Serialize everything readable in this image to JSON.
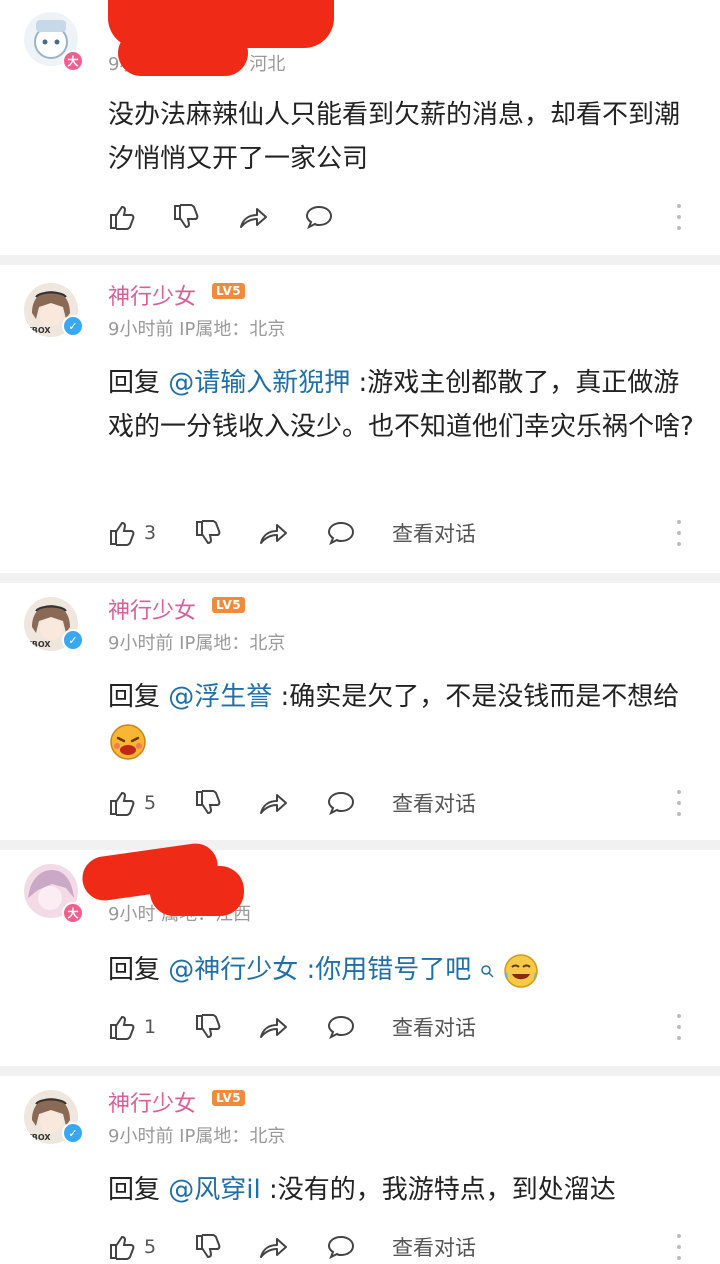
{
  "comments": [
    {
      "name": "",
      "meta": "9小时前 IP属地：河北",
      "body_pre": "没办法麻辣仙人只能看到欠薪的消息，却看不到潮汐悄悄又开了一家公司",
      "reply_to": "",
      "likes": "",
      "view_conversation": ""
    },
    {
      "name": "神行少女",
      "level": "LV5",
      "meta": "9小时前 IP属地：北京",
      "reply_prefix": "回复 ",
      "reply_to": "@请输入新猊押",
      "body": " :游戏主创都散了，真正做游戏的一分钱收入没少。也不知道他们幸灾乐祸个啥?",
      "likes": "3",
      "view_conversation": "查看对话"
    },
    {
      "name": "神行少女",
      "level": "LV5",
      "meta": "9小时前 IP属地：北京",
      "reply_prefix": "回复 ",
      "reply_to": "@浮生誉",
      "body": " :确实是欠了，不是没钱而是不想给",
      "likes": "5",
      "view_conversation": "查看对话"
    },
    {
      "name": "",
      "meta": "9小时前 IP属地：江西",
      "meta_visible": "9小时 属地：江西",
      "reply_prefix": "回复 ",
      "reply_to": "@神行少女",
      "body": " :你用错号了吧",
      "likes": "1",
      "view_conversation": "查看对话"
    },
    {
      "name": "神行少女",
      "level": "LV5",
      "meta": "9小时前 IP属地：北京",
      "reply_prefix": "回复 ",
      "reply_to": "@风穿il",
      "body": " :没有的，我游特点，到处溜达",
      "likes": "5",
      "view_conversation": "查看对话"
    }
  ],
  "badges": {
    "big": "大",
    "check": "✓"
  },
  "colors": {
    "username": "#d8609a",
    "mention": "#1f6fa8",
    "redaction": "#ef2a16"
  }
}
